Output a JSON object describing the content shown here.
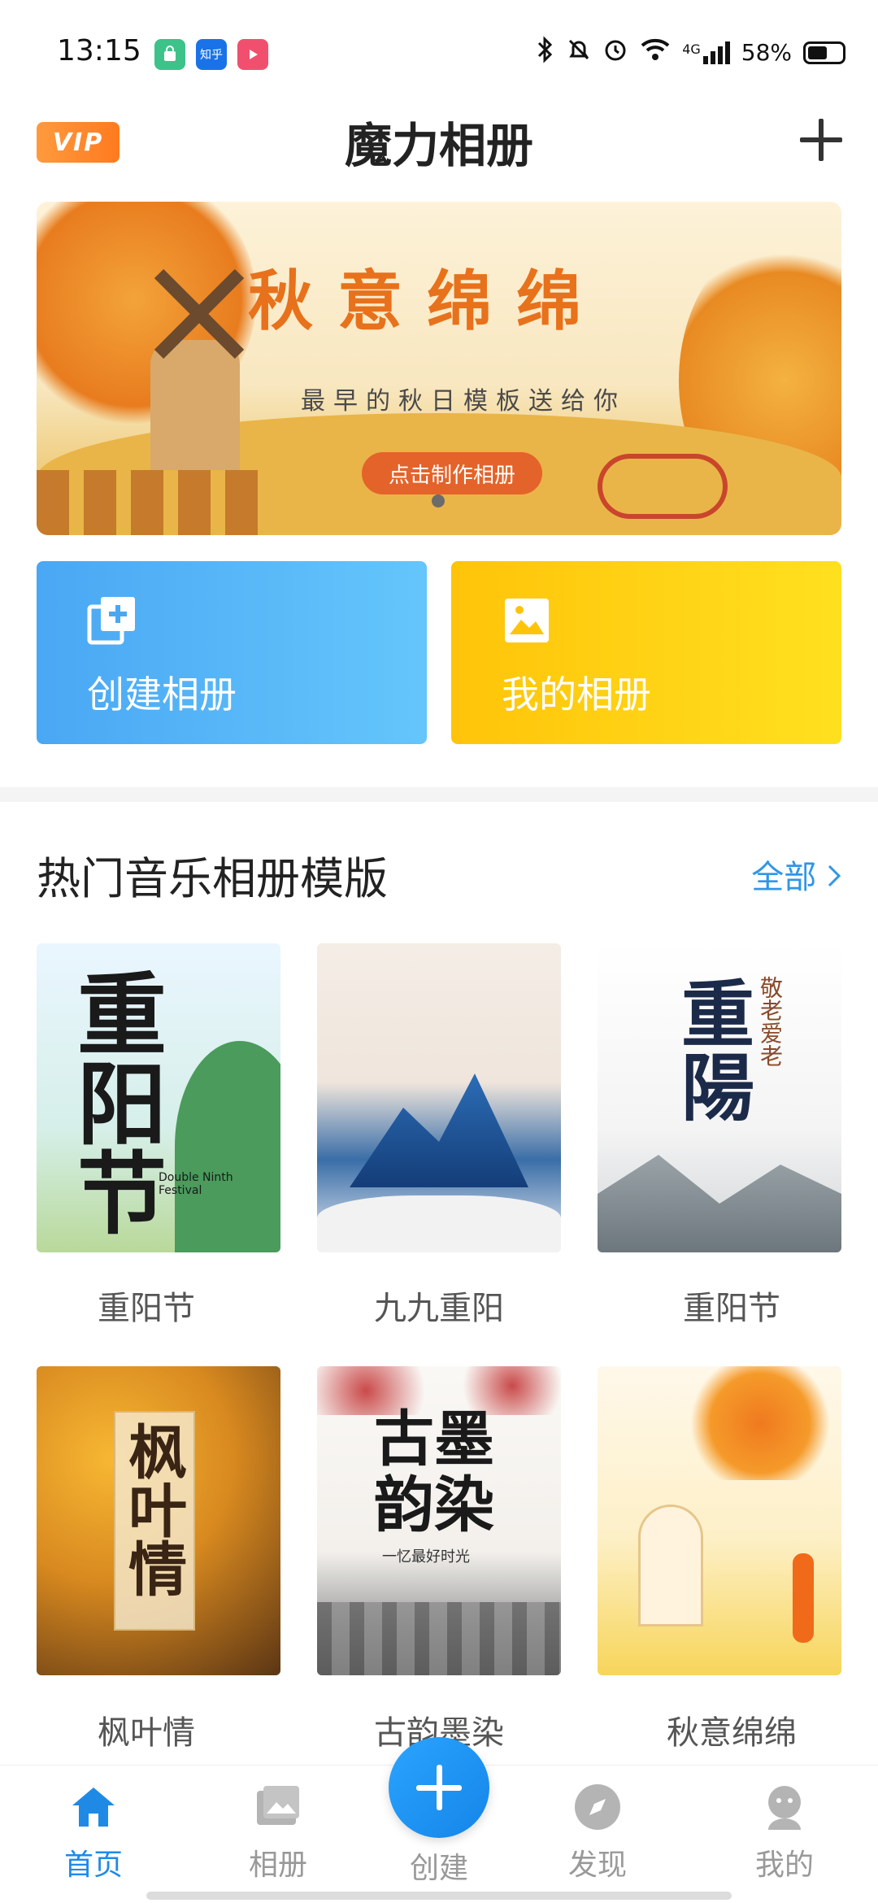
{
  "status_bar": {
    "time": "13:15",
    "apps": [
      {
        "icon": "shopping-bag-icon",
        "color": "#3dc28a",
        "text": ""
      },
      {
        "icon": "zhihu-icon",
        "color": "#1a72e8",
        "text": "知乎"
      },
      {
        "icon": "play-icon",
        "color": "#f0506e",
        "text": ""
      }
    ],
    "network": "4G",
    "battery": "58%",
    "battery_level": 0.58
  },
  "header": {
    "vip_label": "VIP",
    "title": "魔力相册"
  },
  "banner": {
    "title": "秋意绵绵",
    "subtitle": "最早的秋日模板送给你",
    "button": "点击制作相册"
  },
  "actions": {
    "create_label": "创建相册",
    "mine_label": "我的相册"
  },
  "section": {
    "title": "热门音乐相册模版",
    "see_all": "全部"
  },
  "templates": [
    {
      "label": "重阳节",
      "art": "重阳节",
      "sub": "Double Ninth Festival"
    },
    {
      "label": "九九重阳",
      "art": "",
      "sub": ""
    },
    {
      "label": "重阳节",
      "art": "重陽",
      "sub": "敬老爱老"
    },
    {
      "label": "枫叶情",
      "art": "枫叶情",
      "sub": ""
    },
    {
      "label": "古韵墨染",
      "art": "古墨韵染",
      "sub": "一忆最好时光"
    },
    {
      "label": "秋意绵绵",
      "art": "",
      "sub": ""
    }
  ],
  "nav": {
    "home": "首页",
    "album": "相册",
    "create": "创建",
    "discover": "发现",
    "mine": "我的"
  },
  "colors": {
    "accent": "#1f8ae6",
    "vip": "#ff8a2a",
    "create_card": "#4aa7f4",
    "mine_card": "#ffd012"
  }
}
